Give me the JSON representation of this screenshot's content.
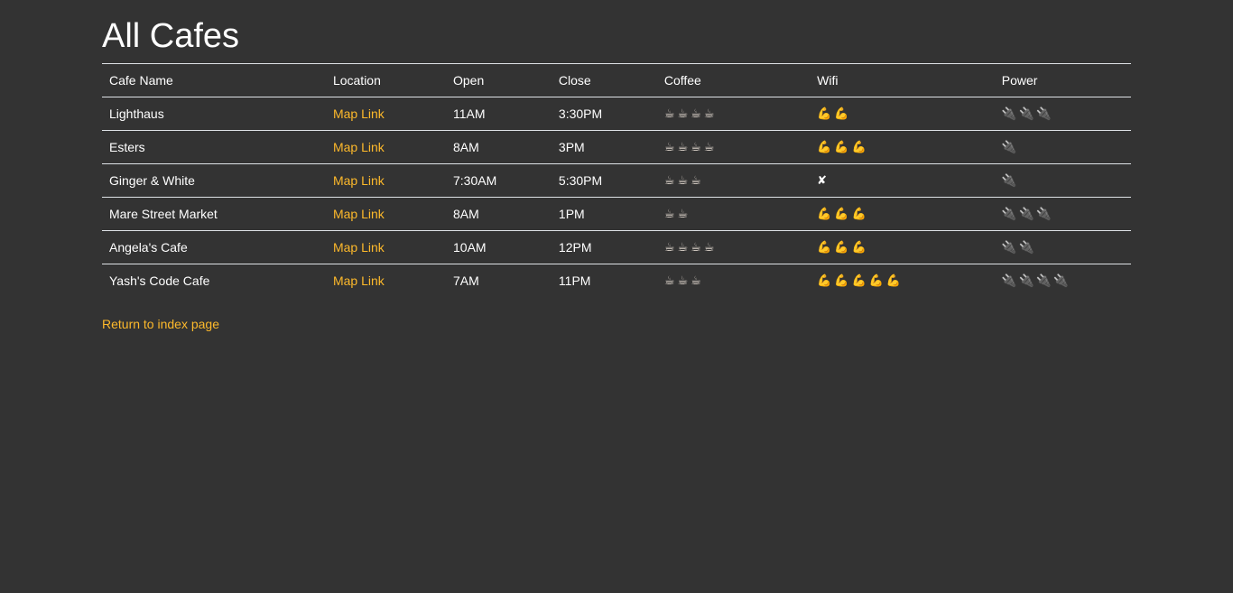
{
  "page": {
    "title": "All Cafes",
    "return_link": "Return to index page"
  },
  "table": {
    "headers": [
      "Cafe Name",
      "Location",
      "Open",
      "Close",
      "Coffee",
      "Wifi",
      "Power"
    ],
    "rows": [
      {
        "name": "Lighthaus",
        "location": "Map Link",
        "open": "11AM",
        "close": "3:30PM",
        "coffee": "☕☕☕☕",
        "wifi": "💪💪",
        "power": "🔌🔌🔌"
      },
      {
        "name": "Esters",
        "location": "Map Link",
        "open": "8AM",
        "close": "3PM",
        "coffee": "☕☕☕☕",
        "wifi": "💪💪💪",
        "power": "🔌"
      },
      {
        "name": "Ginger & White",
        "location": "Map Link",
        "open": "7:30AM",
        "close": "5:30PM",
        "coffee": "☕☕☕",
        "wifi": "✘",
        "power": "🔌"
      },
      {
        "name": "Mare Street Market",
        "location": "Map Link",
        "open": "8AM",
        "close": "1PM",
        "coffee": "☕☕",
        "wifi": "💪💪💪",
        "power": "🔌🔌🔌"
      },
      {
        "name": "Angela's Cafe",
        "location": "Map Link",
        "open": "10AM",
        "close": "12PM",
        "coffee": "☕☕☕☕",
        "wifi": "💪💪💪",
        "power": "🔌🔌"
      },
      {
        "name": "Yash's Code Cafe",
        "location": "Map Link",
        "open": "7AM",
        "close": "11PM",
        "coffee": "☕☕☕",
        "wifi": "💪💪💪💪💪",
        "power": "🔌🔌🔌🔌"
      }
    ]
  },
  "colors": {
    "background": "#333333",
    "link": "#fdb92b",
    "text": "#ffffff",
    "rule": "#dee2e6"
  }
}
